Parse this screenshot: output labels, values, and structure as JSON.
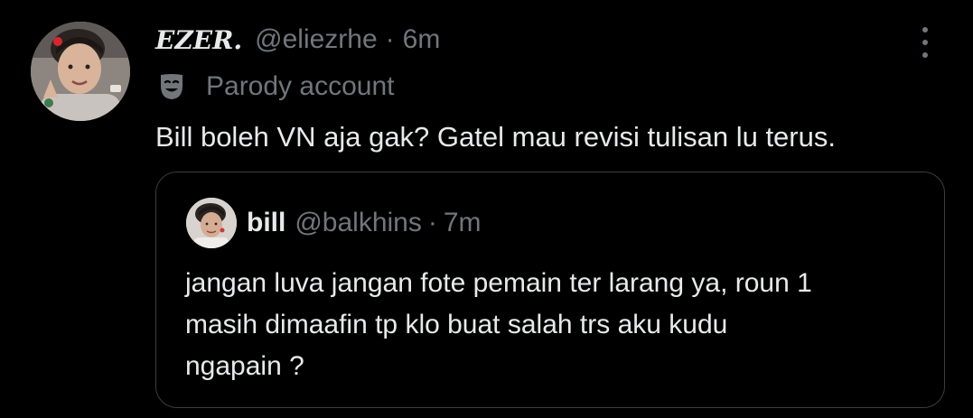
{
  "tweet": {
    "author_name": "EZER.",
    "author_handle": "@eliezrhe",
    "separator": "·",
    "timestamp": "6m",
    "parody_label": "Parody account",
    "text": "Bill boleh VN aja gak? Gatel mau revisi tulisan lu terus."
  },
  "quoted_tweet": {
    "author_name": "bill",
    "author_handle": "@balkhins",
    "separator": "·",
    "timestamp": "7m",
    "text_lines": [
      "jangan luva jangan fote pemain ter larang ya, roun 1",
      "masih dimaafin tp klo buat salah trs aku kudu",
      "ngapain ?"
    ]
  },
  "icons": {
    "more": "more-vertical-icon",
    "parody": "theater-mask-icon"
  },
  "colors": {
    "background": "#000000",
    "primary_text": "#e7e9ea",
    "secondary_text": "#71767b",
    "border": "#3a3d40"
  }
}
